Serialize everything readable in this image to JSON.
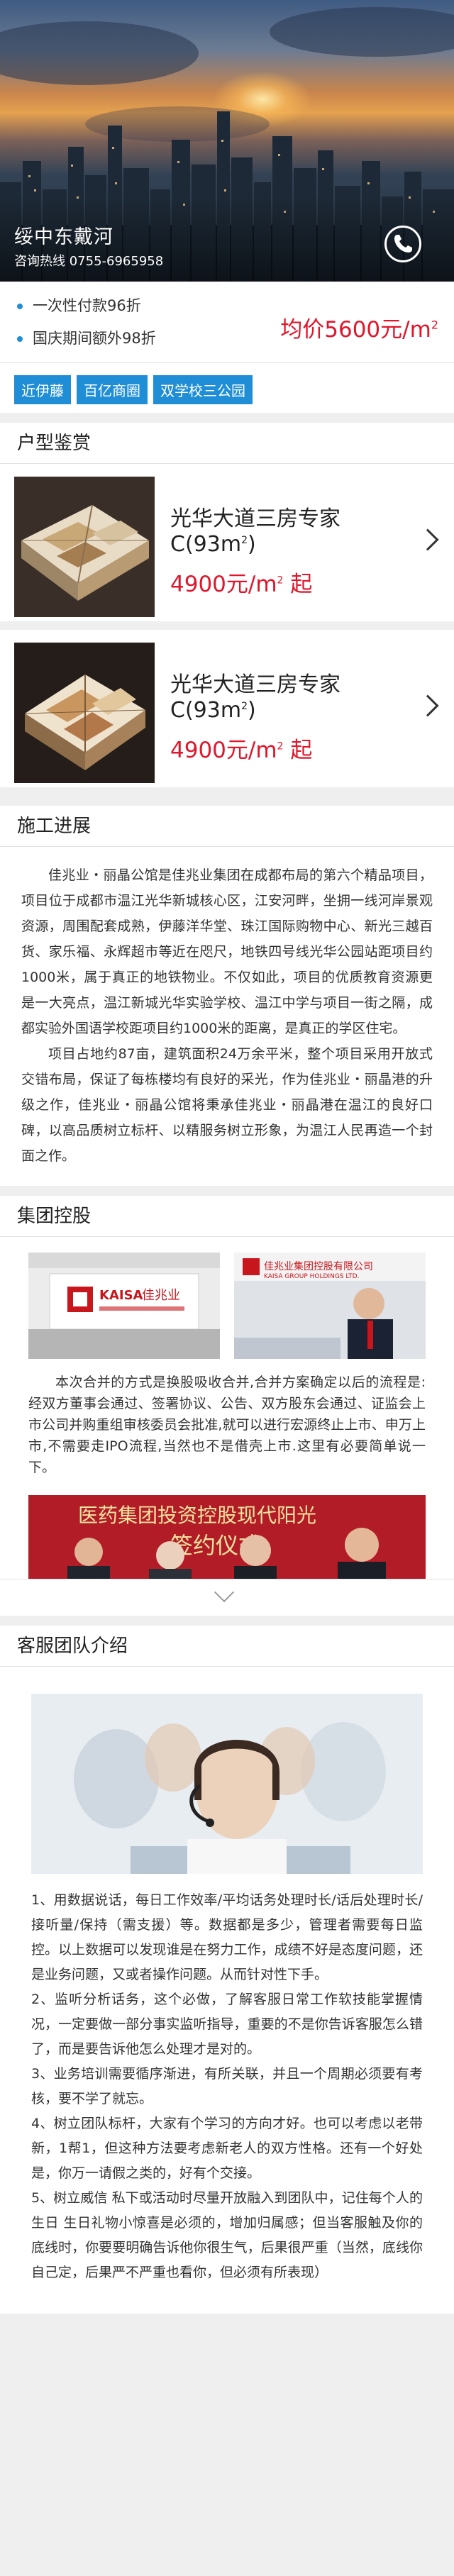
{
  "hero": {
    "title": "绥中东戴河",
    "hotline": "咨询热线  0755-6965958"
  },
  "price": {
    "bullet1": "一次性付款96折",
    "bullet2": "国庆期间额外98折",
    "avg_price": "均价5600元/m",
    "avg_price_sup": "2"
  },
  "tags": [
    "近伊藤",
    "百亿商圈",
    "双学校三公园"
  ],
  "units_section": {
    "title": "户型鉴赏",
    "items": [
      {
        "name": "光华大道三房专家",
        "area": "C(93m",
        "area_sup": "2",
        "area_close": ")",
        "price": "4900元/m",
        "price_sup": "2",
        "price_suffix": " 起"
      },
      {
        "name": "光华大道三房专家",
        "area": "C(93m",
        "area_sup": "2",
        "area_close": ")",
        "price": "4900元/m",
        "price_sup": "2",
        "price_suffix": " 起"
      }
    ]
  },
  "progress": {
    "title": "施工进展",
    "p1": "佳兆业・丽晶公馆是佳兆业集团在成都布局的第六个精品项目，项目位于成都市温江光华新城核心区，江安河畔，坐拥一线河岸景观资源，周围配套成熟，伊藤洋华堂、珠江国际购物中心、新光三越百货、家乐福、永辉超市等近在咫尺，地铁四号线光华公园站距项目约1000米，属于真正的地铁物业。不仅如此，项目的优质教育资源更是一大亮点，温江新城光华实验学校、温江中学与项目一街之隔，成都实验外国语学校距项目约1000米的距离，是真正的学区住宅。",
    "p2": "项目占地约87亩，建筑面积24万余平米，整个项目采用开放式交错布局，保证了每栋楼均有良好的采光，作为佳兆业・丽晶港的升级之作，佳兆业・丽晶公馆将秉承佳兆业・丽晶港在温江的良好口碑，以高品质树立标杆、以精服务树立形象，为温江人民再造一个封面之作。"
  },
  "group": {
    "title": "集团控股",
    "logo_cn": "佳兆业",
    "logo_en": "KAISA",
    "banner_cn": "佳兆业集团控股有限公司",
    "banner_en": "KAISA GROUP HOLDINGS LTD.",
    "text": "本次合并的方式是换股吸收合并,合并方案确定以后的流程是:经双方董事会通过、签署协议、公告、双方股东会通过、证监会上市公司并购重组审核委员会批准,就可以进行宏源终止上市、申万上市,不需要走IPO流程,当然也不是借壳上市.这里有必要简单说一下。",
    "signing_text": "医药集团投资控股现代阳光",
    "signing_sub": "签约仪式"
  },
  "team": {
    "title": "客服团队介绍",
    "paras": [
      "1、用数据说话，每日工作效率/平均话务处理时长/话后处理时长/接听量/保持（需支援）等。数据都是多少，管理者需要每日监控。以上数据可以发现谁是在努力工作，成绩不好是态度问题，还是业务问题，又或者操作问题。从而针对性下手。",
      "2、监听分析话务，这个必做，了解客服日常工作软技能掌握情况，一定要做一部分事实监听指导，重要的不是你告诉客服怎么错了，而是要告诉他怎么处理才是对的。",
      "3、业务培训需要循序渐进，有所关联，并且一个周期必须要有考核，要不学了就忘。",
      "4、树立团队标杆，大家有个学习的方向才好。也可以考虑以老带新，1帮1，但这种方法要考虑新老人的双方性格。还有一个好处是，你万一请假之类的，好有个交接。",
      "5、树立威信  私下或活动时尽量开放融入到团队中，记住每个人的生日 生日礼物小惊喜是必须的，增加归属感；但当客服触及你的底线时，你要要明确告诉他你很生气，后果很严重（当然，底线你自己定，后果严不严重也看你，但必须有所表现）"
    ]
  }
}
